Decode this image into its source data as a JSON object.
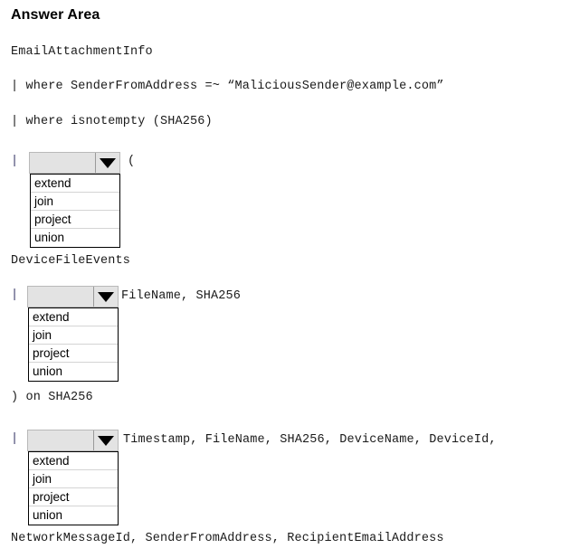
{
  "page": {
    "title": "Answer Area"
  },
  "query": {
    "line_table": "EmailAttachmentInfo",
    "line_where_sender": "| where SenderFromAddress =~ “MaliciousSender@example.com”",
    "line_where_isnotempty": "| where isnotempty (SHA256)",
    "line_pipe_1": "|",
    "line_open_paren": "(",
    "line_device_table": "DeviceFileEvents",
    "line_pipe_2": "|",
    "line_columns_inner": "FileName, SHA256",
    "line_close_on": ") on SHA256",
    "line_pipe_3": "|",
    "line_columns_outer": "Timestamp, FileName, SHA256, DeviceName, DeviceId,",
    "line_columns_outer_cont": "NetworkMessageId, SenderFromAddress, RecipientEmailAddress"
  },
  "dropdowns": [
    {
      "id": "operator-select-1",
      "selected": "",
      "arrow_icon": "chevron-down-icon",
      "options": [
        "extend",
        "join",
        "project",
        "union"
      ]
    },
    {
      "id": "operator-select-2",
      "selected": "",
      "arrow_icon": "chevron-down-icon",
      "options": [
        "extend",
        "join",
        "project",
        "union"
      ]
    },
    {
      "id": "operator-select-3",
      "selected": "",
      "arrow_icon": "chevron-down-icon",
      "options": [
        "extend",
        "join",
        "project",
        "union"
      ]
    }
  ],
  "colors": {
    "combo_fill": "#e3e3e3",
    "combo_border": "#b9b9b9",
    "list_border": "#000000",
    "list_separator": "#d4d4d4",
    "text": "#1a1a1a",
    "pipe": "#3a3a6a"
  }
}
